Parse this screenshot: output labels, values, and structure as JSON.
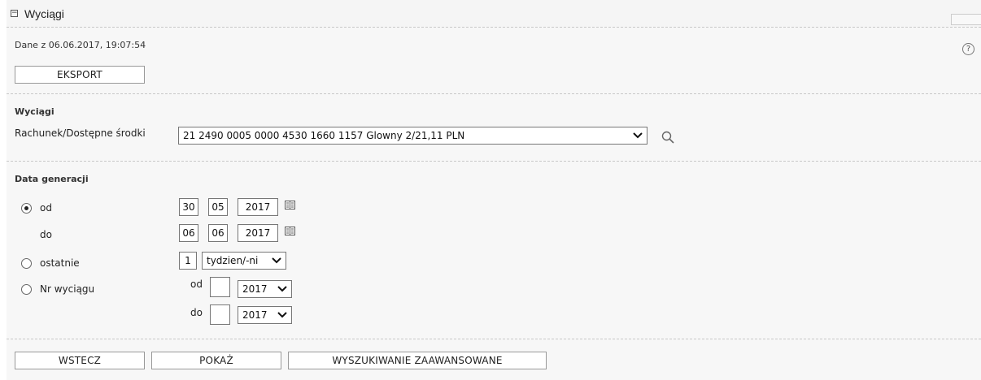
{
  "header": {
    "title": "Wyciągi",
    "toggle_symbol": "⊟"
  },
  "info": {
    "timestamp": "Dane z 06.06.2017, 19:07:54",
    "help_symbol": "?"
  },
  "buttons": {
    "export": "EKSPORT",
    "back": "WSTECZ",
    "show": "POKAŻ",
    "advanced": "WYSZUKIWANIE ZAAWANSOWANE"
  },
  "statements": {
    "section_title": "Wyciągi",
    "account_label": "Rachunek/Dostępne środki",
    "account_value": "21 2490 0005 0000 4530 1660 1157 Glowny 2/21,11 PLN"
  },
  "generation": {
    "section_title": "Data generacji",
    "from_label": "od",
    "to_label": "do",
    "from_date": {
      "day": "30",
      "month": "05",
      "year": "2017"
    },
    "to_date": {
      "day": "06",
      "month": "06",
      "year": "2017"
    },
    "last_label": "ostatnie",
    "last_count": "1",
    "last_unit": "tydzien/-ni",
    "nr_label": "Nr wyciągu",
    "nr_from_label": "od",
    "nr_to_label": "do",
    "nr_from_value": "",
    "nr_from_year": "2017",
    "nr_to_value": "",
    "nr_to_year": "2017",
    "selected_option": "od"
  },
  "icons": {
    "search": "search-icon",
    "calendar": "calendar-icon",
    "dropdown": "chevron-down-icon"
  }
}
